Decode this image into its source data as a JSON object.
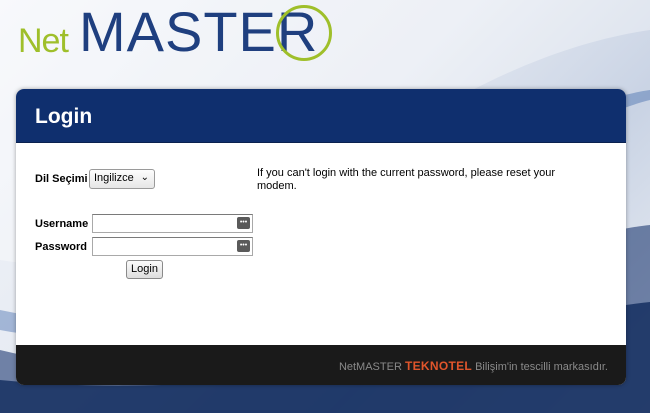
{
  "logo": {
    "net": "Net",
    "master": "MASTER"
  },
  "panel": {
    "title": "Login"
  },
  "language": {
    "label": "Dil Seçimi",
    "selected": "Ingilizce"
  },
  "info": "If you can't login with the current password, please reset your modem.",
  "form": {
    "username_label": "Username",
    "username_value": "",
    "password_label": "Password",
    "password_value": "",
    "login_label": "Login"
  },
  "footer": {
    "prefix": "NetMASTER ",
    "brand": "TEKNOTEL",
    "suffix": " Bilişim'in tescilli markasıdır."
  },
  "colors": {
    "header": "#0f2f6e",
    "logo_green": "#9fbf2a",
    "logo_blue": "#1f3f7f",
    "footer_bg": "#1a1a1a",
    "brand_orange": "#e0552b"
  }
}
